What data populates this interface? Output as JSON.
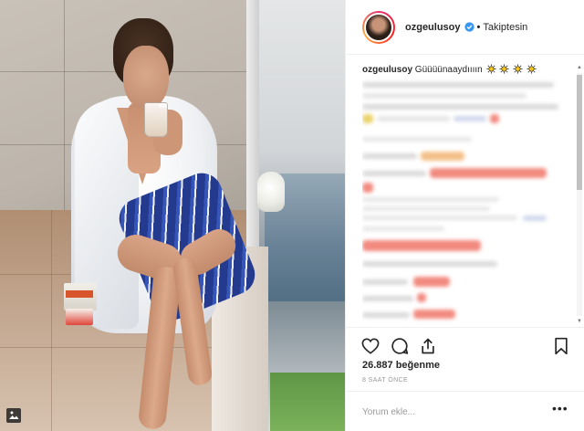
{
  "post": {
    "username": "ozgeulusoy",
    "separator": "•",
    "follow_status": "Takiptesin",
    "caption_username": "ozgeulusoy",
    "caption_text": "Güüüünaaydıııın",
    "caption_emoji_count": 4,
    "likes": "26.887 beğenme",
    "time_ago": "8 SAAT ÖNCE"
  },
  "comment_box": {
    "placeholder": "Yorum ekle...",
    "more_label": "•••"
  },
  "colors": {
    "verified_blue": "#3897f0",
    "text": "#262626",
    "muted": "#999999",
    "border": "#efefef"
  },
  "icons": {
    "like": "heart-icon",
    "comment": "comment-icon",
    "share": "share-icon",
    "save": "bookmark-icon",
    "gallery": "gallery-icon",
    "verified": "verified-badge-icon",
    "emoji": "sun-emoji-icon"
  }
}
